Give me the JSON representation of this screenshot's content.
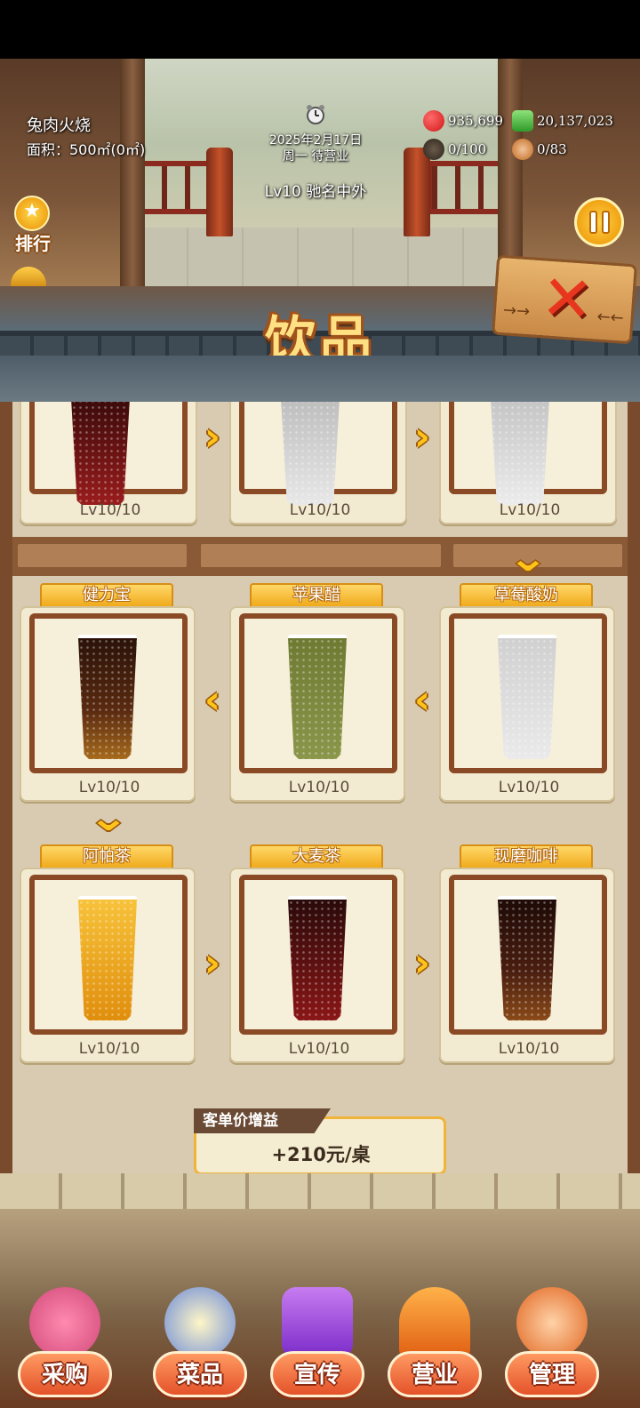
{
  "header": {
    "shop_name": "兔肉火烧",
    "area": "面积：500㎡(0㎡)",
    "date": "2025年2月17日",
    "weekday_status": "周一 待营业",
    "level": "Lv10 驰名中外"
  },
  "resources": {
    "hearts": "935,699",
    "cash": "20,137,023",
    "tables": "0/100",
    "staff": "0/83"
  },
  "buttons": {
    "rank": "排行",
    "close_icon": "close-icon",
    "pause_icon": "pause-icon"
  },
  "panel": {
    "title": "饮品",
    "row1": [
      {
        "level": "Lv10/10",
        "color": "#8a1a1a"
      },
      {
        "level": "Lv10/10",
        "color": "#d9d9d9"
      },
      {
        "level": "Lv10/10",
        "color": "#dcdcdc"
      }
    ],
    "row2": [
      {
        "name": "健力宝",
        "level": "Lv10/10",
        "color": "#5a2a10"
      },
      {
        "name": "苹果醋",
        "level": "Lv10/10",
        "color": "#7c8a3e"
      },
      {
        "name": "草莓酸奶",
        "level": "Lv10/10",
        "color": "#d8d8d8"
      }
    ],
    "row3": [
      {
        "name": "阿帕茶",
        "level": "Lv10/10",
        "color": "#f0a816"
      },
      {
        "name": "大麦茶",
        "level": "Lv10/10",
        "color": "#7a1414"
      },
      {
        "name": "现磨咖啡",
        "level": "Lv10/10",
        "color": "#4a1e10"
      }
    ]
  },
  "bonus": {
    "label": "客单价增益",
    "value": "+210元/桌"
  },
  "nav": [
    {
      "label": "采购",
      "icon": "shop-icon"
    },
    {
      "label": "菜品",
      "icon": "dish-icon"
    },
    {
      "label": "宣传",
      "icon": "video-icon"
    },
    {
      "label": "营业",
      "icon": "service-bell-icon"
    },
    {
      "label": "管理",
      "icon": "staff-icon"
    }
  ]
}
